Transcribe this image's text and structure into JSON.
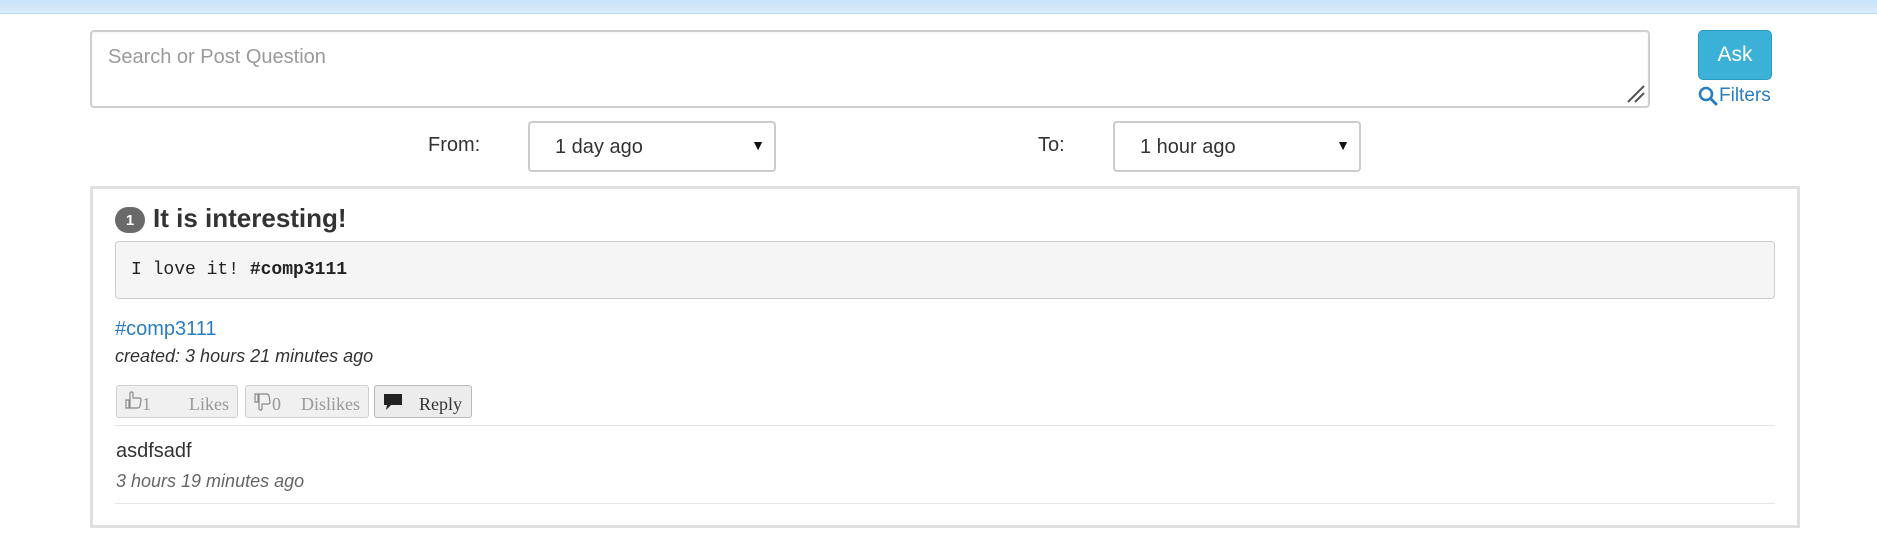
{
  "search": {
    "placeholder": "Search or Post Question",
    "value": ""
  },
  "actions": {
    "ask_label": "Ask",
    "filters_label": "Filters"
  },
  "date_range": {
    "from_label": "From:",
    "from_value": "1 day ago",
    "to_label": "To:",
    "to_value": "1 hour ago"
  },
  "post": {
    "index": "1",
    "title": "It is interesting!",
    "body_text": "I love it! ",
    "body_tag": "#comp3111",
    "tag": "#comp3111",
    "created": "created: 3 hours 21 minutes ago",
    "likes_count": "1",
    "likes_label": "Likes",
    "dislikes_count": "0",
    "dislikes_label": "Dislikes",
    "reply_label": "Reply"
  },
  "replies": [
    {
      "text": "asdfsadf",
      "time": "3 hours 19 minutes ago"
    }
  ],
  "colors": {
    "accent": "#3bb1d8",
    "link": "#2a7dc0",
    "top_strip": "#c9e3f9"
  },
  "icons": [
    "search-icon",
    "thumbs-up-icon",
    "thumbs-down-icon",
    "comment-icon",
    "resize-handle-icon",
    "caret-down-icon"
  ]
}
